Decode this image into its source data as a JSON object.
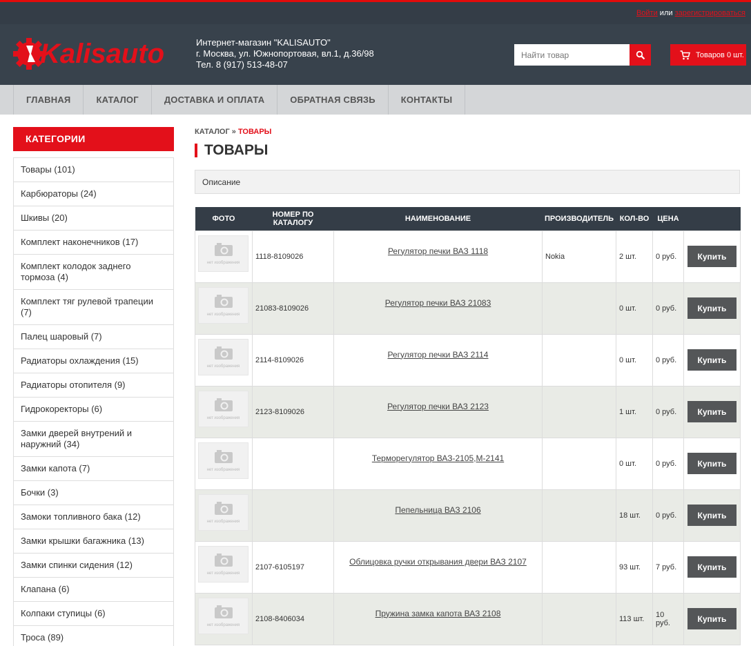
{
  "topbar": {
    "login": "Войти",
    "or": "или",
    "register": "зарегистрироваться"
  },
  "header": {
    "logo_text": "Kalisauto",
    "store_name": "Интернет-магазин \"KALISAUTO\"",
    "address": "г. Москва, ул. Южнопортовая, вл.1, д.36/98",
    "phone": "Тел. 8 (917) 513-48-07",
    "search_placeholder": "Найти товар",
    "cart_label": "Товаров 0 шт."
  },
  "nav": {
    "items": [
      "Главная",
      "Каталог",
      "Доставка и оплата",
      "Обратная связь",
      "Контакты"
    ]
  },
  "sidebar": {
    "heading": "КАТЕГОРИИ",
    "items": [
      "Товары (101)",
      "Карбюраторы (24)",
      "Шкивы (20)",
      "Комплект наконечников (17)",
      "Комплект колодок заднего тормоза (4)",
      "Комплект тяг рулевой трапеции (7)",
      "Палец шаровый (7)",
      "Радиаторы охлаждения (15)",
      "Радиаторы отопителя (9)",
      "Гидрокоректоры (6)",
      "Замки дверей внутрений и наружний (34)",
      "Замки капота (7)",
      "Бочки (3)",
      "Замоки топливного бака (12)",
      "Замки крышки багажника (13)",
      "Замки спинки сидения (12)",
      "Клапана (6)",
      "Колпаки ступицы (6)",
      "Троса (89)"
    ]
  },
  "main": {
    "breadcrumb_catalog": "КАТАЛОГ",
    "breadcrumb_sep": "»",
    "breadcrumb_current": "ТОВАРЫ",
    "title": "ТОВАРЫ",
    "description": "Описание",
    "columns": [
      "ФОТО",
      "НОМЕР ПО КАТАЛОГУ",
      "НАИМЕНОВАНИЕ",
      "ПРОИЗВОДИТЕЛЬ",
      "КОЛ-ВО",
      "ЦЕНА",
      ""
    ],
    "no_image_text": "нет изображения",
    "buy_label": "Купить",
    "products": [
      {
        "sku": "1118-8109026",
        "name": "Регулятор печки ВАЗ 1118",
        "maker": "Nokia",
        "qty": "2 шт.",
        "price": "0 руб."
      },
      {
        "sku": "21083-8109026",
        "name": "Регулятор печки ВАЗ 21083",
        "maker": "",
        "qty": "0 шт.",
        "price": "0 руб."
      },
      {
        "sku": "2114-8109026",
        "name": "Регулятор печки ВАЗ 2114",
        "maker": "",
        "qty": "0 шт.",
        "price": "0 руб."
      },
      {
        "sku": "2123-8109026",
        "name": "Регулятор печки ВАЗ 2123",
        "maker": "",
        "qty": "1 шт.",
        "price": "0 руб."
      },
      {
        "sku": "",
        "name": "Терморегулятор ВАЗ-2105,М-2141",
        "maker": "",
        "qty": "0 шт.",
        "price": "0 руб."
      },
      {
        "sku": "",
        "name": "Пепельница ВАЗ 2106",
        "maker": "",
        "qty": "18 шт.",
        "price": "0 руб."
      },
      {
        "sku": "2107-6105197",
        "name": "Облицовка ручки открывания двери ВАЗ 2107",
        "maker": "",
        "qty": "93 шт.",
        "price": "7 руб."
      },
      {
        "sku": "2108-8406034",
        "name": "Пружина замка капота ВАЗ 2108",
        "maker": "",
        "qty": "113 шт.",
        "price": "10 руб."
      }
    ]
  },
  "colors": {
    "accent": "#e3101a",
    "header_bg": "#38424c",
    "topbar_bg": "#343d47",
    "nav_bg": "#d4d6d8",
    "button_bg": "#545658"
  }
}
